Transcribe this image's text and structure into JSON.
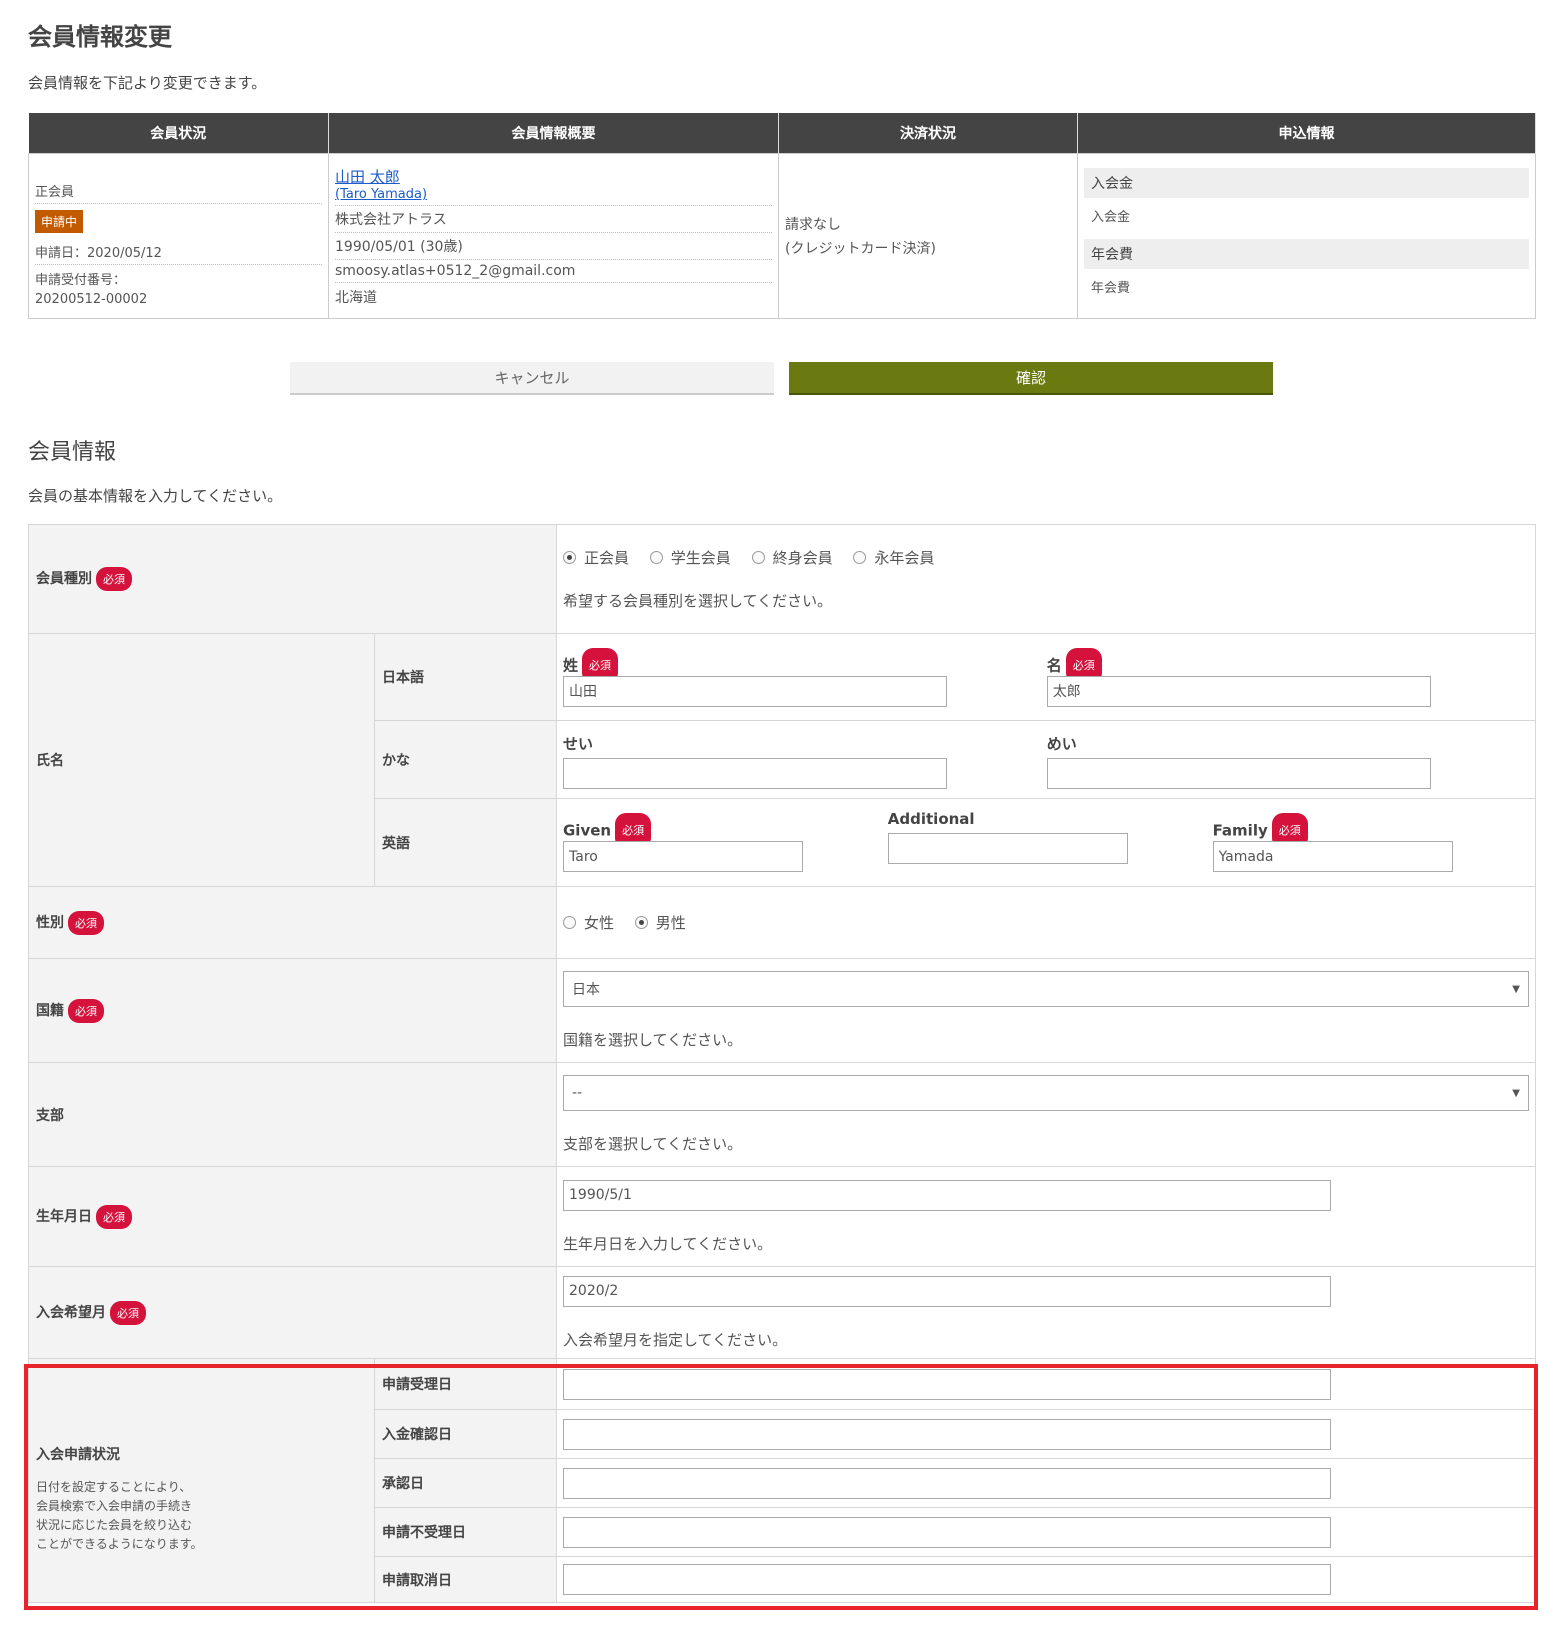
{
  "page": {
    "title": "会員情報変更",
    "lead": "会員情報を下記より変更できます。"
  },
  "summary": {
    "headers": [
      "会員状況",
      "会員情報概要",
      "決済状況",
      "申込情報"
    ],
    "status": {
      "type": "正会員",
      "badge": "申請中",
      "apply_date": "申請日：2020/05/12",
      "receipt_label": "申請受付番号：",
      "receipt_no": "20200512-00002"
    },
    "profile": {
      "name": "山田 太郎",
      "name_en": "(Taro Yamada)",
      "company": "株式会社アトラス",
      "birth": "1990/05/01 (30歳)",
      "email": "smoosy.atlas+0512_2@gmail.com",
      "pref": "北海道"
    },
    "payment": {
      "line1": "請求なし",
      "line2": "(クレジットカード決済)"
    },
    "application": {
      "h1": "入会金",
      "v1": "入会金",
      "h2": "年会費",
      "v2": "年会費"
    }
  },
  "buttons": {
    "cancel": "キャンセル",
    "confirm": "確認"
  },
  "section": {
    "title": "会員情報",
    "lead": "会員の基本情報を入力してください。"
  },
  "required": "必須",
  "form": {
    "member_type": {
      "label": "会員種別",
      "options": [
        "正会員",
        "学生会員",
        "終身会員",
        "永年会員"
      ],
      "selected": "正会員",
      "help": "希望する会員種別を選択してください。"
    },
    "name": {
      "label": "氏名",
      "ja": {
        "label": "日本語",
        "last_label": "姓",
        "last_value": "山田",
        "first_label": "名",
        "first_value": "太郎"
      },
      "kana": {
        "label": "かな",
        "last_label": "せい",
        "last_value": "",
        "first_label": "めい",
        "first_value": ""
      },
      "en": {
        "label": "英語",
        "given_label": "Given",
        "given_value": "Taro",
        "additional_label": "Additional",
        "additional_value": "",
        "family_label": "Family",
        "family_value": "Yamada"
      }
    },
    "gender": {
      "label": "性別",
      "options": [
        "女性",
        "男性"
      ],
      "selected": "男性"
    },
    "nationality": {
      "label": "国籍",
      "value": "日本",
      "help": "国籍を選択してください。"
    },
    "branch": {
      "label": "支部",
      "value": "--",
      "help": "支部を選択してください。"
    },
    "birthday": {
      "label": "生年月日",
      "value": "1990/5/1",
      "help": "生年月日を入力してください。"
    },
    "join_month": {
      "label": "入会希望月",
      "value": "2020/2",
      "help": "入会希望月を指定してください。"
    },
    "application_status": {
      "label": "入会申請状況",
      "note": [
        "日付を設定することにより、",
        "会員検索で入会申請の手続き",
        "状況に応じた会員を絞り込む",
        "ことができるようになります。"
      ],
      "fields": [
        "申請受理日",
        "入金確認日",
        "承認日",
        "申請不受理日",
        "申請取消日"
      ]
    }
  }
}
